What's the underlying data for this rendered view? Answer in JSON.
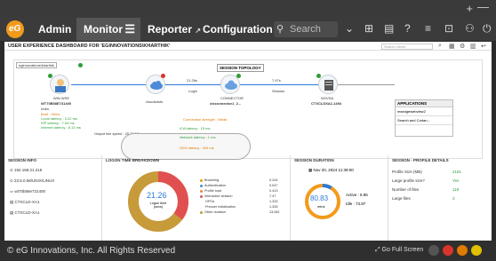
{
  "navbar": {
    "tabs": [
      {
        "label": "Admin"
      },
      {
        "label": "Monitor"
      },
      {
        "label": "Reporter"
      },
      {
        "label": "Configuration"
      }
    ],
    "search_placeholder": "Search"
  },
  "dashboard": {
    "title": "USER EXPERIENCE DASHBOARD FOR 'EGINNOVATIONS\\KHARTHIK'",
    "search_placeholder": "Search Users"
  },
  "topology": {
    "pill": "SESSION TOPOLOGY",
    "user_label": "eginnovations\\kharthik",
    "client_caption": "WIN WSE",
    "client_name": "WT70B58E731400",
    "client_loc": "India",
    "client_metrics": [
      "Brufl : 90ms",
      "Local latency : 3.22 ms",
      "ISP latency : 7.04 ms",
      "Internet latency : 8.13 ms"
    ],
    "cloud_caption": "cloudsdots",
    "login_time": "21.26s",
    "login_label": "Login",
    "connector_caption": "CONNECTOR",
    "connector_name": "ctxconnector1_2...",
    "session_time": "7.47s",
    "session_label": "Session",
    "vda_caption": "W2VDA",
    "vda_name": "CTXCLDXA1.1494",
    "apps_header": "APPLICATIONS",
    "apps": [
      "msedgewebview2",
      "Search and Cortan..."
    ],
    "output_line": "Output line speed : 25.39 Mbps",
    "connection_strength": "Connection strength : Weak",
    "icr_latency": "ICA latency : 15 ms",
    "network_latency": "Network latency : 1 ms",
    "hdx_latency": "HDX latency : 403 ms"
  },
  "session_info": {
    "title": "SESSION INFO",
    "rows": [
      "192.168.21.216",
      "23.5.0.58/UNIX/LINUX",
      "wt70b58e731400",
      "CTXCLD-XA1",
      "CTXCLD-XA1"
    ]
  },
  "logon": {
    "title": "LOGON TIME BREAKDOWN",
    "center_value": "21.26",
    "center_label": "Logon time (secs)",
    "items": [
      {
        "label": "Brokering",
        "value": "0.244",
        "color": "#e0a000"
      },
      {
        "label": "Authentication",
        "value": "0.047",
        "color": "#4a8ad8"
      },
      {
        "label": "Profile load",
        "value": "0.413",
        "color": "#e08a40"
      },
      {
        "label": "Interactive session",
        "value": "7.47",
        "color": "#e05050"
      },
      {
        "label": "GPOs",
        "value": "1.333",
        "color": ""
      },
      {
        "label": "Preuser initialization",
        "value": "1.328",
        "color": ""
      },
      {
        "label": "Other duration",
        "value": "13.081",
        "color": "#c79a3a"
      }
    ]
  },
  "duration": {
    "title": "SESSION DURATION",
    "start": "Nov 20, 2024 11:39:00",
    "center_value": "80.83",
    "center_unit": "mins",
    "active": "Active : 6.96",
    "idle": "Idle : 73.87"
  },
  "profile": {
    "title": "SESSION - PROFILE DETAILS",
    "rows": [
      {
        "label": "Profile Size (MB)",
        "value": "2181"
      },
      {
        "label": "Large profile size?",
        "value": "Yes"
      },
      {
        "label": "Number of files",
        "value": "118"
      },
      {
        "label": "Large files",
        "value": "3"
      }
    ]
  },
  "footer": {
    "copyright": "© eG Innovations, Inc. All Rights Reserved",
    "fullscreen": "Go Full Screen"
  },
  "colors": {
    "accent": "#f29a1b",
    "nav_bg": "#3b3b3b",
    "link_blue": "#2a7ad8",
    "good_green": "#2e9c38"
  }
}
